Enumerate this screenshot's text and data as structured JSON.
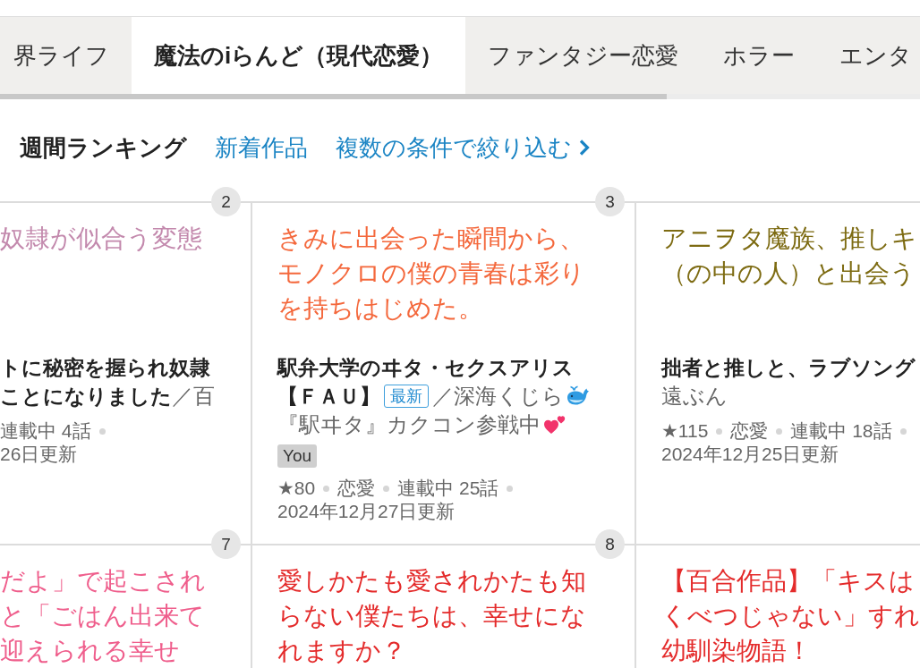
{
  "category_tabs": [
    {
      "label": "界ライフ",
      "selected": false
    },
    {
      "label": "魔法のiらんど（現代恋愛）",
      "selected": true
    },
    {
      "label": "ファンタジー恋愛",
      "selected": false
    },
    {
      "label": "ホラー",
      "selected": false
    },
    {
      "label": "エンタ",
      "selected": false
    }
  ],
  "ranking_nav": {
    "tabs": [
      {
        "label": "週間ランキング",
        "selected": true
      },
      {
        "label": "新着作品",
        "selected": false
      }
    ],
    "filter_link": "複数の条件で絞り込む"
  },
  "cards": [
    {
      "rank": "2",
      "color": "#c389ad",
      "catch_lines": [
        "奴隷が似合う変態"
      ],
      "title_lines": [
        "トに秘密を握られ奴隷",
        "ことになりました"
      ],
      "author_parts": [
        {
          "kind": "text",
          "text": "／百"
        }
      ],
      "meta": [
        "連載中 4話"
      ],
      "updated": "26日更新"
    },
    {
      "rank": "3",
      "color": "#f4683c",
      "catch_lines": [
        "きみに出会った瞬間から、",
        "モノクロの僕の青春は彩り",
        "を持ちはじめた。"
      ],
      "title_lines": [
        "駅弁大学のヰタ・セクスアリス",
        "【ＦＡＵ】"
      ],
      "badge": "最新",
      "author_parts": [
        {
          "kind": "text",
          "text": "／深海くじら"
        },
        {
          "kind": "whale"
        },
        {
          "kind": "text",
          "text": "『駅ヰタ』カクコン参戦中"
        },
        {
          "kind": "hearts"
        }
      ],
      "tags": [
        "You"
      ],
      "meta": [
        "★80",
        "恋愛",
        "連載中 25話"
      ],
      "updated": "2024年12月27日更新"
    },
    {
      "color": "#7d6b12",
      "catch_lines": [
        "アニヲタ魔族、推しキ",
        "（の中の人）と出会う"
      ],
      "title_lines": [
        "拙者と推しと、ラブソング"
      ],
      "author_parts": [
        {
          "kind": "text",
          "text": "遠ぶん"
        }
      ],
      "meta": [
        "★115",
        "恋愛",
        "連載中 18話"
      ],
      "updated": "2024年12月25日更新"
    },
    {
      "rank": "7",
      "color": "#ef5e8c",
      "catch_lines": [
        "だよ」で起こされ",
        "と「ごはん出来て",
        "迎えられる幸せ"
      ]
    },
    {
      "rank": "8",
      "color": "#e42b2b",
      "catch_lines": [
        "愛しかたも愛されかたも知",
        "らない僕たちは、幸せにな",
        "れますか？"
      ]
    },
    {
      "color": "#e42b2b",
      "catch_lines": [
        "【百合作品】「キスは",
        "くべつじゃない」すれ",
        "幼馴染物語！"
      ]
    }
  ]
}
